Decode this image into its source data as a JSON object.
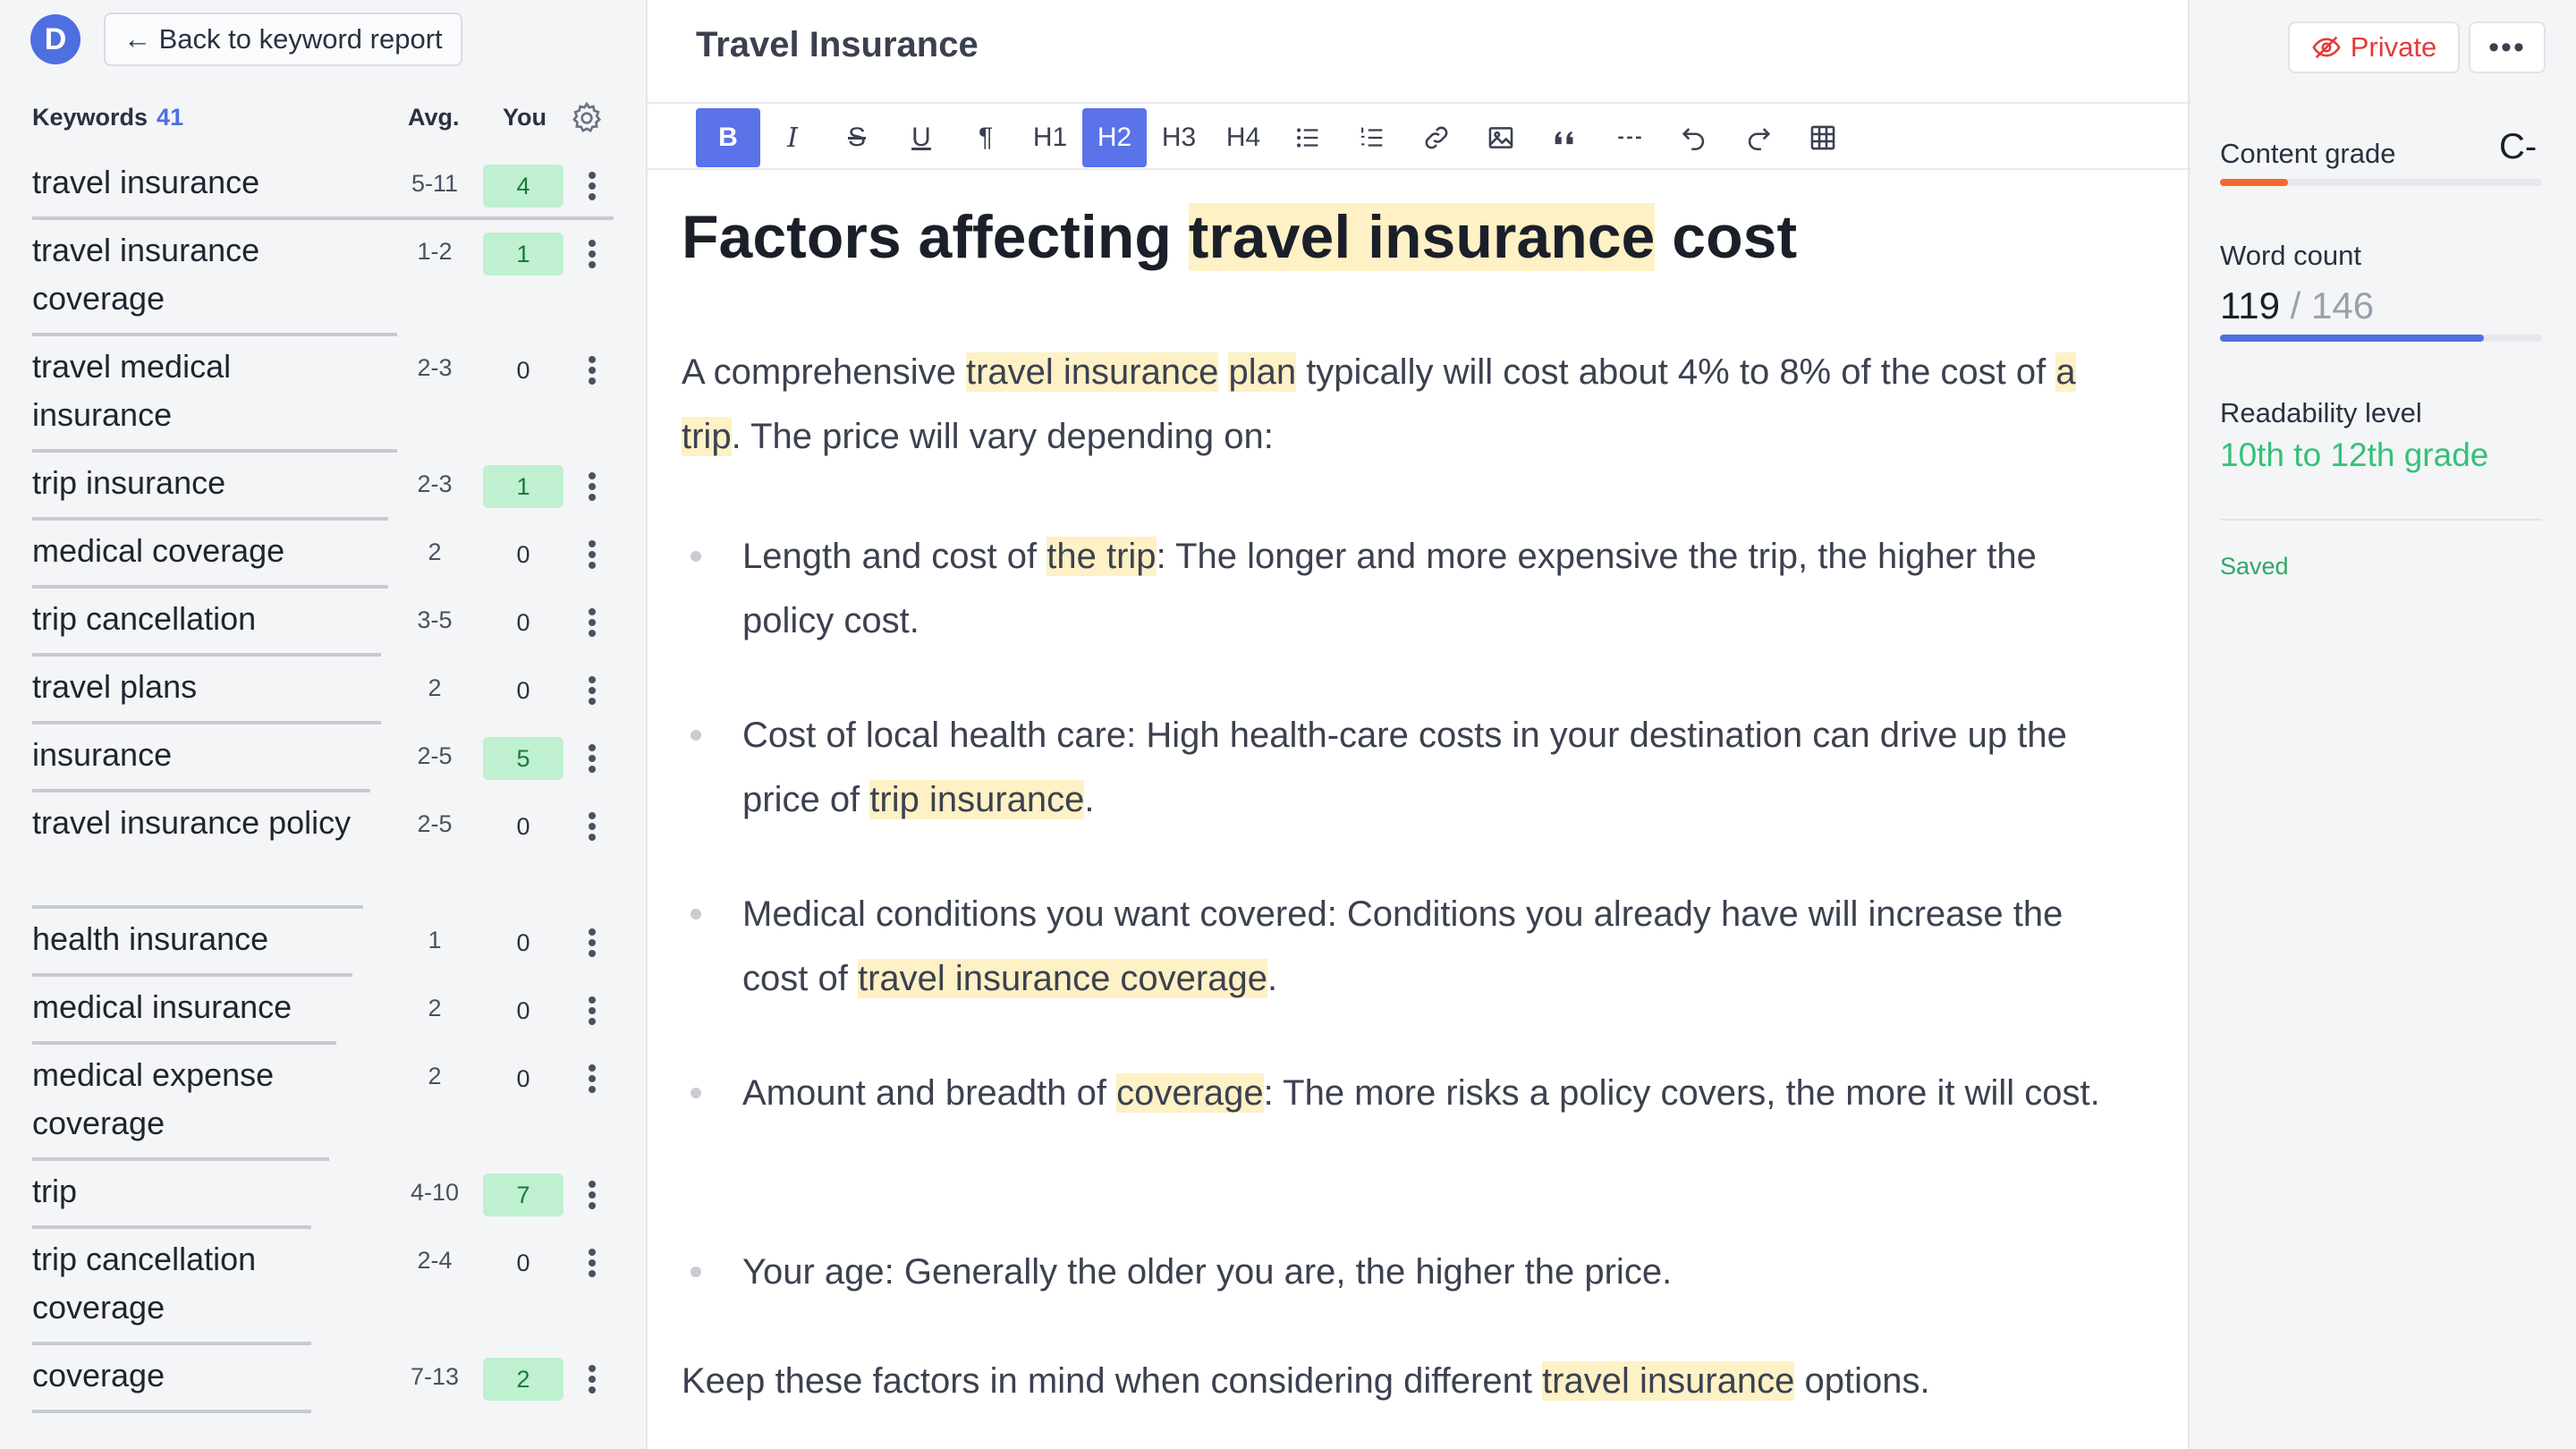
{
  "sidebar": {
    "logo_letter": "D",
    "back_label": "← Back to keyword report",
    "header": {
      "title": "Keywords",
      "count": "41",
      "avg": "Avg.",
      "you": "You"
    },
    "keywords": [
      {
        "name": "travel insurance",
        "avg": "5-11",
        "you": "4",
        "hit": true
      },
      {
        "name": "travel insurance coverage",
        "avg": "1-2",
        "you": "1",
        "hit": true
      },
      {
        "name": "travel medical insurance",
        "avg": "2-3",
        "you": "0",
        "hit": false
      },
      {
        "name": "trip insurance",
        "avg": "2-3",
        "you": "1",
        "hit": true
      },
      {
        "name": "medical coverage",
        "avg": "2",
        "you": "0",
        "hit": false
      },
      {
        "name": "trip cancellation",
        "avg": "3-5",
        "you": "0",
        "hit": false
      },
      {
        "name": "travel plans",
        "avg": "2",
        "you": "0",
        "hit": false
      },
      {
        "name": "insurance",
        "avg": "2-5",
        "you": "5",
        "hit": true
      },
      {
        "name": "travel insurance policy",
        "avg": "2-5",
        "you": "0",
        "hit": false
      },
      {
        "name": "health insurance",
        "avg": "1",
        "you": "0",
        "hit": false
      },
      {
        "name": "medical insurance",
        "avg": "2",
        "you": "0",
        "hit": false
      },
      {
        "name": "medical expense coverage",
        "avg": "2",
        "you": "0",
        "hit": false
      },
      {
        "name": "trip",
        "avg": "4-10",
        "you": "7",
        "hit": true
      },
      {
        "name": "trip cancellation coverage",
        "avg": "2-4",
        "you": "0",
        "hit": false
      },
      {
        "name": "coverage",
        "avg": "7-13",
        "you": "2",
        "hit": true
      }
    ]
  },
  "editor": {
    "doc_title": "Travel Insurance",
    "toolbar": [
      "B",
      "I",
      "S",
      "U",
      "¶",
      "H1",
      "H2",
      "H3",
      "H4"
    ],
    "heading": {
      "pre": "Factors affecting ",
      "hl": "travel insurance",
      "post": " cost"
    },
    "intro": {
      "t1": "A comprehensive ",
      "h1": "travel insurance",
      "t2": " ",
      "h2": "plan",
      "t3": " typically will cost about 4% to 8% of the cost of ",
      "h3": "a trip",
      "t4": ". The price will vary depending on:"
    },
    "bullets": [
      {
        "pre": "Length and cost of ",
        "hl": "the trip",
        "post": ": The longer and more expensive the trip, the higher the policy cost."
      },
      {
        "pre": "Cost of local health care: High health-care costs in your destination can drive up the price of ",
        "hl": "trip insurance",
        "post": "."
      },
      {
        "pre": "Medical conditions you want covered: Conditions you already have will increase the cost of ",
        "hl": "travel insurance coverage",
        "post": "."
      },
      {
        "pre": "Amount and breadth of ",
        "hl": "coverage",
        "post": ": The more risks a policy covers, the more it will cost."
      },
      {
        "pre": "Your age: Generally the older you are, the higher the price.",
        "hl": "",
        "post": ""
      }
    ],
    "outro": {
      "pre": "Keep these factors in mind when considering different ",
      "hl": "travel insurance",
      "post": " options."
    }
  },
  "right_panel": {
    "private_label": "Private",
    "menu_label": "•••",
    "content_grade_label": "Content grade",
    "content_grade": "C-",
    "content_grade_fraction": 0.21,
    "word_count_label": "Word count",
    "word_count": "119",
    "word_count_target": " / 146",
    "word_count_fraction": 0.82,
    "readability_label": "Readability level",
    "readability": "10th to 12th grade",
    "saved_label": "Saved",
    "colors": {
      "grade": "#f06a2c",
      "wordcount": "#4f6fe0",
      "accent": "#5b73e8",
      "highlight": "#fdf1c5",
      "success": "#35c07a"
    }
  }
}
